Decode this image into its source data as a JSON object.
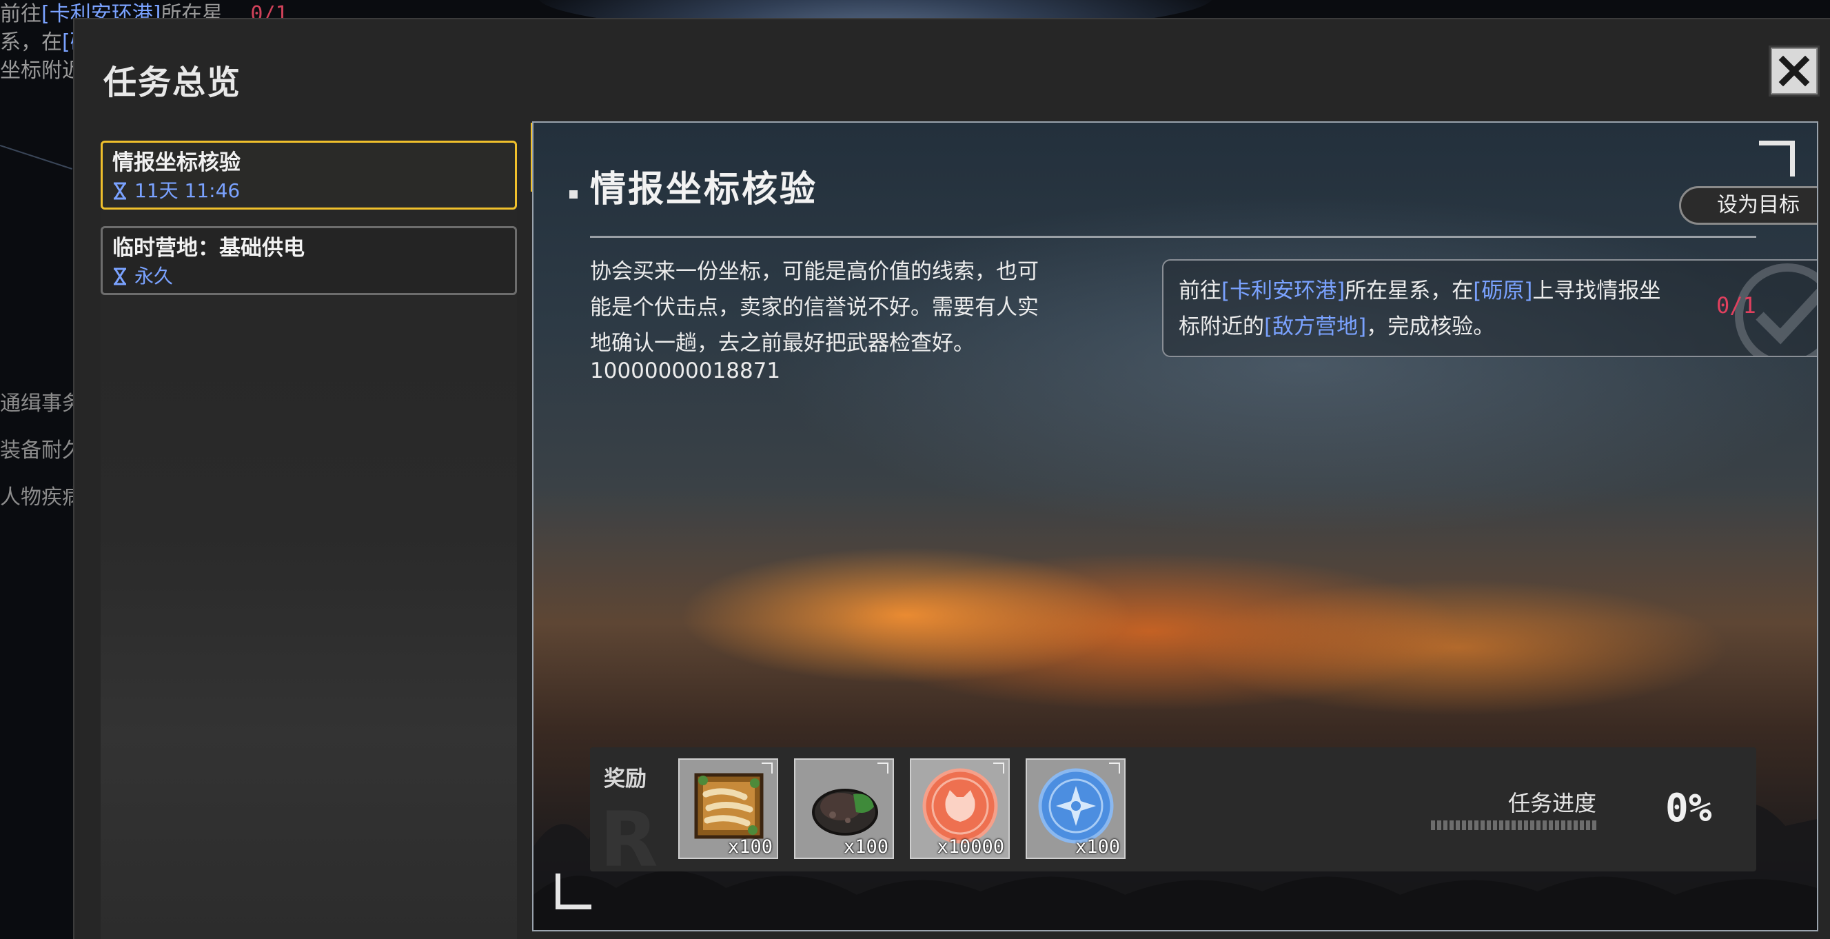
{
  "background_hud": {
    "line1_prefix": "前往",
    "line1_tag": "[卡利安环港]",
    "line1_suffix": "所在星",
    "line1_count": "0/1",
    "line2_prefix": "系，在",
    "line2_tag": "[砺",
    "line3": "坐标附近",
    "side_items": [
      "通缉事务",
      "装备耐久",
      "人物疾病"
    ]
  },
  "dialog": {
    "title": "任务总览",
    "close_icon": "close-icon"
  },
  "quest_list": [
    {
      "name": "情报坐标核验",
      "time": "11天 11:46",
      "active": true
    },
    {
      "name": "临时营地：基础供电",
      "time": "永久",
      "active": false
    }
  ],
  "detail": {
    "title": "情报坐标核验",
    "set_target_label": "设为目标",
    "description": "协会买来一份坐标，可能是高价值的线索，也可能是个伏击点，卖家的信誉说不好。需要有人实地确认一趟，去之前最好把武器检查好。",
    "description_id": "10000000018871",
    "objective": {
      "p1": "前往",
      "tag1": "[卡利安环港]",
      "p2": "所在星系，在",
      "tag2": "[砺原]",
      "p3": "上寻找情报坐标附近的",
      "tag3": "[敌方营地]",
      "p4": "，完成核验。",
      "progress": "0/1",
      "check_icon": "checkmark-icon"
    },
    "rewards": {
      "label": "奖励",
      "ghost_text": "R",
      "items": [
        {
          "icon": "crate-icon",
          "qty": "x100"
        },
        {
          "icon": "ore-icon",
          "qty": "x100"
        },
        {
          "icon": "orange-badge-icon",
          "qty": "x10000"
        },
        {
          "icon": "blue-compass-icon",
          "qty": "x100"
        }
      ]
    },
    "progress": {
      "label": "任务进度",
      "value": "0%"
    }
  },
  "colors": {
    "accent": "#f0c02c",
    "link": "#7aa2ff",
    "count": "#e0405e"
  }
}
